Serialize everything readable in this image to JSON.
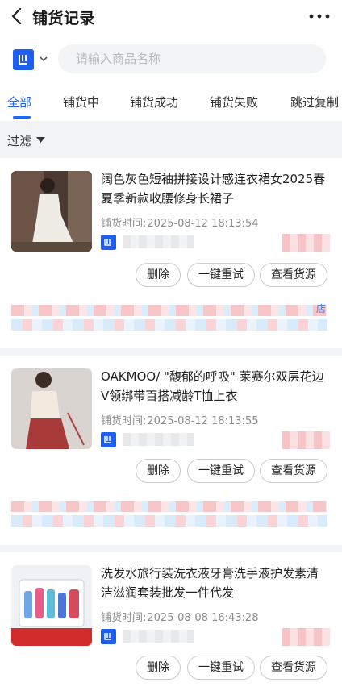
{
  "header": {
    "title": "铺货记录"
  },
  "search": {
    "placeholder": "请输入商品名称"
  },
  "tabs": [
    {
      "label": "全部",
      "active": true
    },
    {
      "label": "铺货中",
      "active": false
    },
    {
      "label": "铺货成功",
      "active": false
    },
    {
      "label": "铺货失败",
      "active": false
    },
    {
      "label": "跳过复制",
      "active": false
    }
  ],
  "filter": {
    "label": "过滤"
  },
  "records": [
    {
      "title": "阔色灰色短袖拼接设计感连衣裙女2025春夏季新款收腰修身长裙子",
      "time_label": "铺货时间:",
      "time": "2025-08-12 18:13:54",
      "error_tail": "店"
    },
    {
      "title": "OAKMOO/ \"馥郁的呼吸\" 莱赛尔双层花边V领绑带百搭减龄T恤上衣",
      "time_label": "铺货时间:",
      "time": "2025-08-12 18:13:55",
      "error_tail": ""
    },
    {
      "title": "洗发水旅行装洗衣液牙膏洗手液护发素清洁滋润套装批发一件代发",
      "time_label": "铺货时间:",
      "time": "2025-08-08 16:43:28",
      "error_tail": ""
    }
  ],
  "actions": {
    "delete": "删除",
    "retry": "一键重试",
    "source": "查看货源"
  },
  "colors": {
    "accent": "#1e66f5",
    "platform_logo": "#1e5ef0"
  }
}
